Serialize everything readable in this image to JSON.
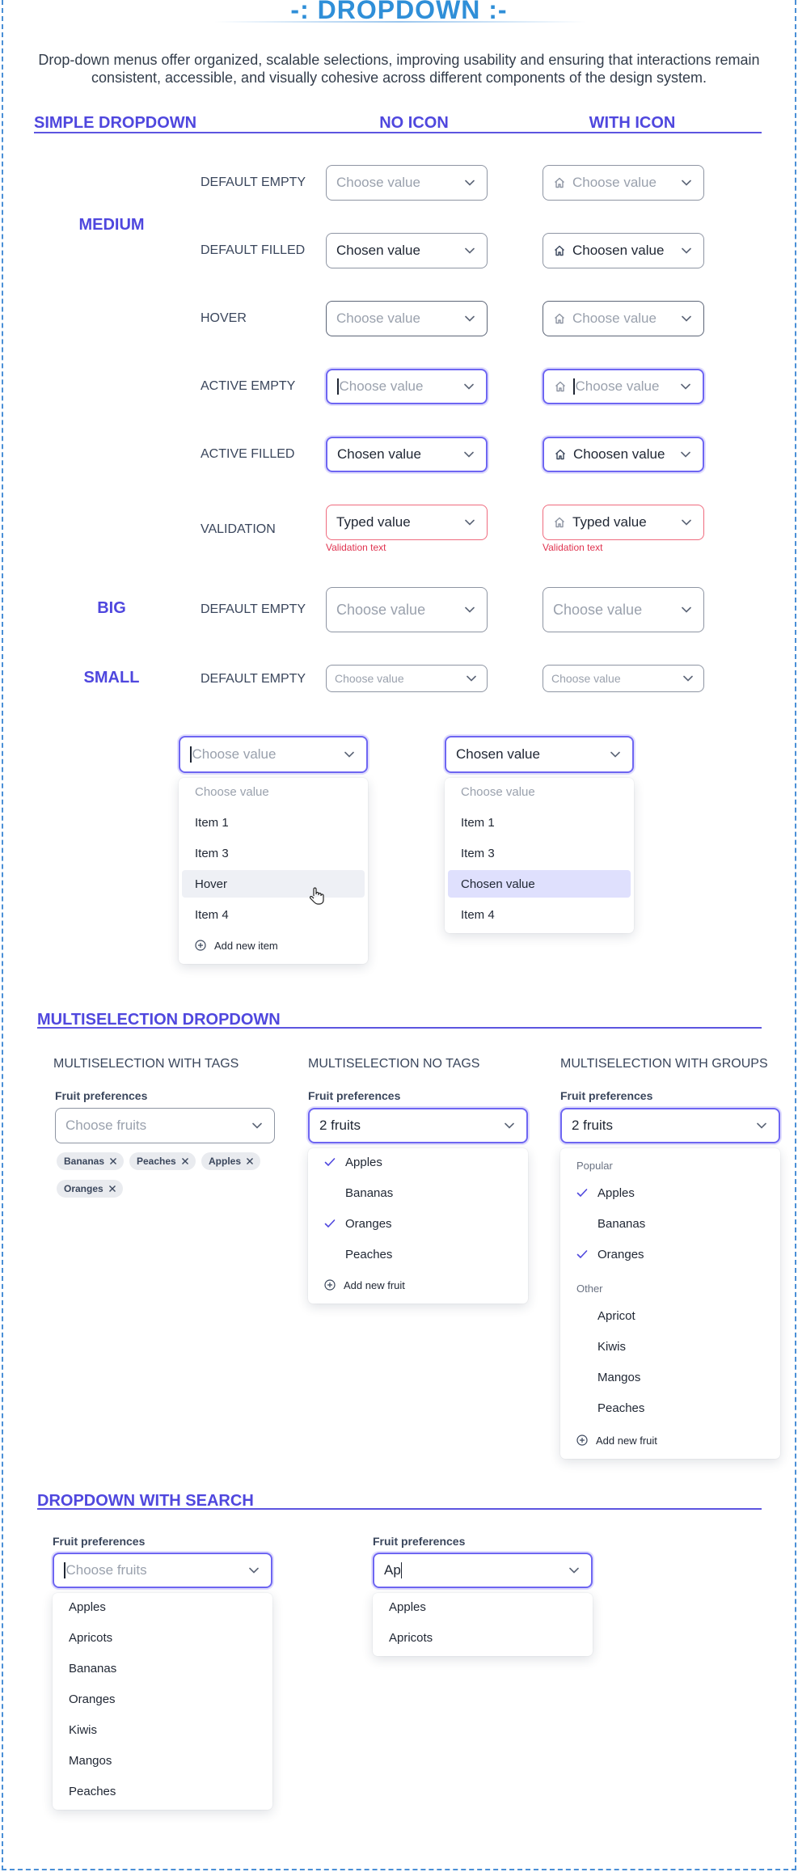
{
  "title": "-: DROPDOWN :-",
  "description": "Drop-down menus offer organized, scalable selections, improving usability and ensuring that interactions remain consistent, accessible, and visually cohesive across different components of the design system.",
  "simple": {
    "heading": "SIMPLE DROPDOWN",
    "col_no_icon": "NO ICON",
    "col_with_icon": "WITH ICON",
    "sizes": {
      "medium": "MEDIUM",
      "big": "BIG",
      "small": "SMALL"
    },
    "rows": {
      "default_empty": {
        "label": "DEFAULT EMPTY",
        "no_icon": "Choose value",
        "with_icon": "Choose value"
      },
      "default_filled": {
        "label": "DEFAULT FILLED",
        "no_icon": "Chosen value",
        "with_icon": "Choosen value"
      },
      "hover": {
        "label": "HOVER",
        "no_icon": "Choose value",
        "with_icon": "Choose value"
      },
      "active_empty": {
        "label": "ACTIVE EMPTY",
        "no_icon": "Choose value",
        "with_icon": "Choose value"
      },
      "active_filled": {
        "label": "ACTIVE FILLED",
        "no_icon": "Chosen value",
        "with_icon": "Choosen value"
      },
      "validation": {
        "label": "VALIDATION",
        "no_icon": "Typed value",
        "with_icon": "Typed value",
        "error_text": "Validation text"
      },
      "big_default_empty": {
        "label": "DEFAULT EMPTY",
        "no_icon": "Choose value",
        "with_icon": "Choose value"
      },
      "small_default_empty": {
        "label": "DEFAULT EMPTY",
        "no_icon": "Choose value",
        "with_icon": "Choose value"
      }
    },
    "open_menu_1": {
      "value": "Choose value",
      "items": [
        "Choose value",
        "Item 1",
        "Item 3",
        "Hover",
        "Item 4"
      ],
      "add_label": "Add new item"
    },
    "open_menu_2": {
      "value": "Chosen value",
      "items": [
        "Choose value",
        "Item 1",
        "Item 3",
        "Chosen value",
        "Item 4"
      ]
    }
  },
  "multi": {
    "heading": "MULTISELECTION DROPDOWN",
    "with_tags": {
      "title": "MULTISELECTION WITH TAGS",
      "field_label": "Fruit preferences",
      "placeholder": "Choose fruits",
      "tags": [
        "Bananas",
        "Peaches",
        "Apples",
        "Oranges"
      ]
    },
    "no_tags": {
      "title": "MULTISELECTION NO TAGS",
      "field_label": "Fruit preferences",
      "value": "2 fruits",
      "items": [
        "Apples",
        "Bananas",
        "Oranges",
        "Peaches"
      ],
      "checked": [
        true,
        false,
        true,
        false
      ],
      "add_label": "Add new fruit"
    },
    "with_groups": {
      "title": "MULTISELECTION WITH GROUPS",
      "field_label": "Fruit preferences",
      "value": "2 fruits",
      "group1": "Popular",
      "group1_items": [
        "Apples",
        "Bananas",
        "Oranges"
      ],
      "group1_checked": [
        true,
        false,
        true
      ],
      "group2": "Other",
      "group2_items": [
        "Apricot",
        "Kiwis",
        "Mangos",
        "Peaches"
      ],
      "add_label": "Add new fruit"
    }
  },
  "search": {
    "heading": "DROPDOWN WITH SEARCH",
    "left": {
      "field_label": "Fruit preferences",
      "placeholder": "Choose fruits",
      "items": [
        "Apples",
        "Apricots",
        "Bananas",
        "Oranges",
        "Kiwis",
        "Mangos",
        "Peaches"
      ]
    },
    "right": {
      "field_label": "Fruit preferences",
      "typed": "Ap",
      "items": [
        "Apples",
        "Apricots"
      ]
    }
  },
  "colors": {
    "accent": "#4f47de",
    "title": "#2f8fd8",
    "error": "#e0334f",
    "active_border": "#6e66f2",
    "dashed_border": "#4a8fd6"
  },
  "icons": [
    "chevron-down-icon",
    "home-icon",
    "plus-circle-icon",
    "check-icon",
    "close-icon",
    "hand-pointer-icon"
  ]
}
